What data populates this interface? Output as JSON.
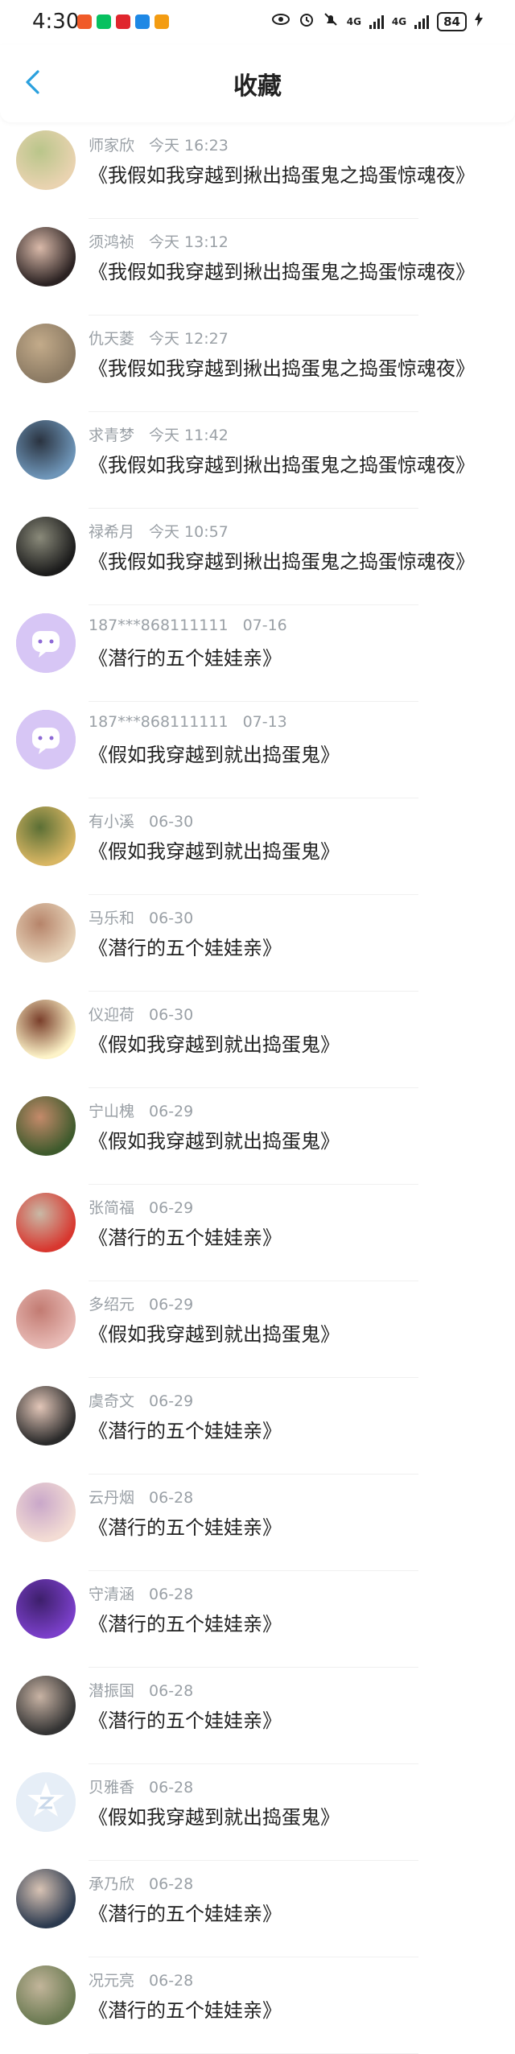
{
  "status_bar": {
    "time": "4:30",
    "apps": [
      {
        "icon": "app-icon-orange",
        "color": "#f05a28"
      },
      {
        "icon": "wechat-icon",
        "color": "#07c160"
      },
      {
        "icon": "app-icon-red",
        "color": "#e0262d"
      },
      {
        "icon": "app-icon-blue",
        "color": "#1e88e5"
      },
      {
        "icon": "app-icon-orange2",
        "color": "#f39c12"
      }
    ],
    "network_label_1": "4G",
    "network_label_2": "4G",
    "battery": "84"
  },
  "header": {
    "title": "收藏"
  },
  "items": [
    {
      "name": "师家欣",
      "time": "今天 16:23",
      "title": "《我假如我穿越到揪出捣蛋鬼之捣蛋惊魂夜》",
      "avatar_colors": [
        "#e9d3b0",
        "#b9c58a"
      ]
    },
    {
      "name": "须鸿祯",
      "time": "今天 13:12",
      "title": "《我假如我穿越到揪出捣蛋鬼之捣蛋惊魂夜》",
      "avatar_colors": [
        "#2b2222",
        "#d9b9a9"
      ]
    },
    {
      "name": "仇天菱",
      "time": "今天 12:27",
      "title": "《我假如我穿越到揪出捣蛋鬼之捣蛋惊魂夜》",
      "avatar_colors": [
        "#8b7a63",
        "#c3ab8a"
      ]
    },
    {
      "name": "求青梦",
      "time": "今天 11:42",
      "title": "《我假如我穿越到揪出捣蛋鬼之捣蛋惊魂夜》",
      "avatar_colors": [
        "#6e95b8",
        "#2a3340"
      ]
    },
    {
      "name": "禄希月",
      "time": "今天 10:57",
      "title": "《我假如我穿越到揪出捣蛋鬼之捣蛋惊魂夜》",
      "avatar_colors": [
        "#1b1b1b",
        "#8a8a7a"
      ]
    },
    {
      "name": "187***868111111",
      "time": "07-16",
      "title": "《潜行的五个娃娃亲》",
      "avatar_colors": [
        "#d9c7f2",
        "#b99ae8"
      ]
    },
    {
      "name": "187***868111111",
      "time": "07-13",
      "title": "《假如我穿越到就出捣蛋鬼》",
      "avatar_colors": [
        "#d9c7f2",
        "#b99ae8"
      ]
    },
    {
      "name": "有小溪",
      "time": "06-30",
      "title": "《假如我穿越到就出捣蛋鬼》",
      "avatar_colors": [
        "#d8b663",
        "#5b6f35"
      ]
    },
    {
      "name": "马乐和",
      "time": "06-30",
      "title": "《潜行的五个娃娃亲》",
      "avatar_colors": [
        "#e6d2b8",
        "#b6846a"
      ]
    },
    {
      "name": "仪迎荷",
      "time": "06-30",
      "title": "《假如我穿越到就出捣蛋鬼》",
      "avatar_colors": [
        "#fdf3c8",
        "#7a3f2b"
      ]
    },
    {
      "name": "宁山槐",
      "time": "06-29",
      "title": "《假如我穿越到就出捣蛋鬼》",
      "avatar_colors": [
        "#3e5a2c",
        "#c48a6a"
      ]
    },
    {
      "name": "张简福",
      "time": "06-29",
      "title": "《潜行的五个娃娃亲》",
      "avatar_colors": [
        "#d8372f",
        "#c9b9a6"
      ]
    },
    {
      "name": "多绍元",
      "time": "06-29",
      "title": "《假如我穿越到就出捣蛋鬼》",
      "avatar_colors": [
        "#e7b9b4",
        "#c27b72"
      ]
    },
    {
      "name": "虞奇文",
      "time": "06-29",
      "title": "《潜行的五个娃娃亲》",
      "avatar_colors": [
        "#2a2a2a",
        "#e2c6b8"
      ]
    },
    {
      "name": "云丹烟",
      "time": "06-28",
      "title": "《潜行的五个娃娃亲》",
      "avatar_colors": [
        "#f3dcd4",
        "#c9a7c9"
      ]
    },
    {
      "name": "守清涵",
      "time": "06-28",
      "title": "《潜行的五个娃娃亲》",
      "avatar_colors": [
        "#7a3fc9",
        "#3d1f6b"
      ]
    },
    {
      "name": "潜振国",
      "time": "06-28",
      "title": "《潜行的五个娃娃亲》",
      "avatar_colors": [
        "#333333",
        "#c8b3a4"
      ]
    },
    {
      "name": "贝雅香",
      "time": "06-28",
      "title": "《假如我穿越到就出捣蛋鬼》",
      "avatar_colors": [
        "#e3ecf6",
        "#cfdbe9"
      ]
    },
    {
      "name": "承乃欣",
      "time": "06-28",
      "title": "《潜行的五个娃娃亲》",
      "avatar_colors": [
        "#2c3a4f",
        "#d8c3b4"
      ]
    },
    {
      "name": "况元亮",
      "time": "06-28",
      "title": "《潜行的五个娃娃亲》",
      "avatar_colors": [
        "#6b7a52",
        "#c2b59a"
      ]
    }
  ]
}
